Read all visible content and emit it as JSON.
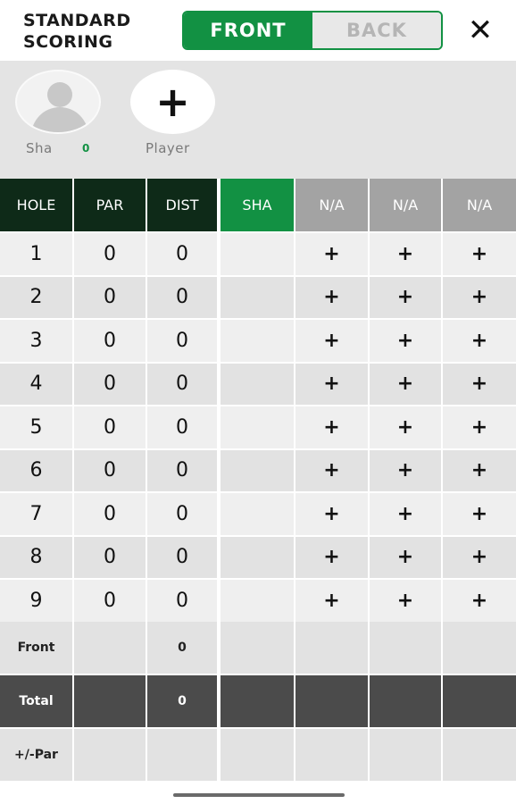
{
  "header": {
    "title_line1": "STANDARD",
    "title_line2": "SCORING",
    "toggle_front": "FRONT",
    "toggle_back": "BACK",
    "close_glyph": "✕"
  },
  "players": {
    "player1": {
      "name": "Sha",
      "score": "0"
    },
    "add_player": {
      "glyph": "+",
      "label": "Player"
    }
  },
  "table": {
    "columns": [
      "HOLE",
      "PAR",
      "DIST",
      "SHA",
      "N/A",
      "N/A",
      "N/A"
    ],
    "rows": [
      {
        "hole": "1",
        "par": "0",
        "dist": "0"
      },
      {
        "hole": "2",
        "par": "0",
        "dist": "0"
      },
      {
        "hole": "3",
        "par": "0",
        "dist": "0"
      },
      {
        "hole": "4",
        "par": "0",
        "dist": "0"
      },
      {
        "hole": "5",
        "par": "0",
        "dist": "0"
      },
      {
        "hole": "6",
        "par": "0",
        "dist": "0"
      },
      {
        "hole": "7",
        "par": "0",
        "dist": "0"
      },
      {
        "hole": "8",
        "par": "0",
        "dist": "0"
      },
      {
        "hole": "9",
        "par": "0",
        "dist": "0"
      }
    ],
    "add_score_glyph": "+",
    "front": {
      "label": "Front",
      "dist": "0"
    },
    "total": {
      "label": "Total",
      "dist": "0"
    },
    "plus_minus_par": {
      "label": "+/-Par"
    }
  },
  "colors": {
    "accent_green": "#129143",
    "header_dark": "#0e2a18",
    "total_row": "#4b4b4b"
  }
}
